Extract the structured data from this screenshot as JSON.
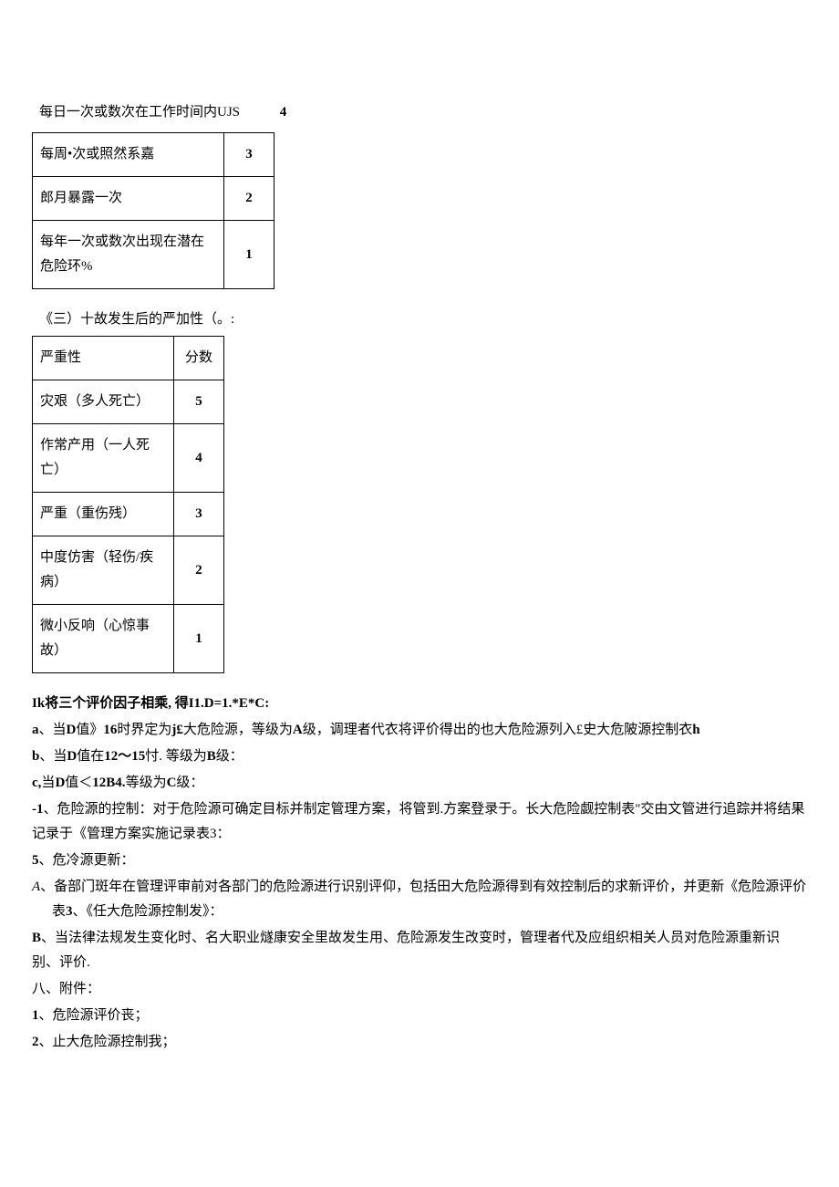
{
  "preTable1": {
    "leftText": "每日一次或数次在工作时间内UJS",
    "rightText": "4"
  },
  "table1": {
    "rows": [
      {
        "label": "每周•次或照然系嘉",
        "score": "3"
      },
      {
        "label": "郎月暴露一次",
        "score": "2"
      },
      {
        "label": "每年一次或数次出现在潜在危险环%",
        "score": "1"
      }
    ]
  },
  "section2Title": "《三）十故发生后的严加性（。:",
  "table2": {
    "header": {
      "label": "严重性",
      "score": "分数"
    },
    "rows": [
      {
        "label": "灾艰（多人死亡）",
        "score": "5"
      },
      {
        "label": "作常产用（一人死亡）",
        "score": "4"
      },
      {
        "label": "严重（重伤残）",
        "score": "3"
      },
      {
        "label": "中度仿害（轻伤/疾病）",
        "score": "2"
      },
      {
        "label": "微小反响（心惊事故）",
        "score": "1"
      }
    ]
  },
  "paras": {
    "p1_prefix": "Ik",
    "p1_rest": "将三个评价因子相乘, 得I1.D=1.*E*C:",
    "p2_prefix": "a",
    "p2_mid1": "、当",
    "p2_mid2": "D",
    "p2_mid3": "值》",
    "p2_mid4": "16",
    "p2_mid5": "时界定为",
    "p2_mid6": "j£",
    "p2_mid7": "大危险源，等级为",
    "p2_mid8": "A",
    "p2_mid9": "级，调理者代衣将评价得出的也大危险源列入£史大危陂源控制衣",
    "p2_suffix": "h",
    "p3_prefix": "b",
    "p3_mid1": "、当",
    "p3_mid2": "D",
    "p3_mid3": "值在",
    "p3_mid4": "12〜15",
    "p3_mid5": "忖. 等级为",
    "p3_mid6": "B",
    "p3_mid7": "级：",
    "p4_prefix": "c,",
    "p4_mid1": "当",
    "p4_mid2": "D",
    "p4_mid3": "值＜",
    "p4_mid4": "12B4.",
    "p4_mid5": "等级为",
    "p4_mid6": "C",
    "p4_mid7": "级：",
    "p5_prefix": "-1",
    "p5_rest": "、危险源的控制：对于危险源可确定目标并制定管理方案，将管到.方案登录于。长大危险觑控制表\"交由文管进行追踪并将结果记录于《管理方案实施记录表3：",
    "p6_prefix": "5",
    "p6_rest": "、危冷源更新：",
    "p7_prefix": "A",
    "p7_mid1": "、备部门斑年在管理评审前对各部门的危险源进行识别评仰，包括田大危险源得到有效控制后的求新评价，并更新《危险源评价表",
    "p7_mid2": "3",
    "p7_mid3": "、《任大危险源控制发》：",
    "p8_prefix": "B",
    "p8_rest": "、当法律法规发生变化时、名大职业燧康安全里故发生用、危险源发生改变时，管理者代及应组织相关人员对危险源重新识别、评价.",
    "p9": "八、附件：",
    "p10_prefix": "1",
    "p10_rest": "、危险源评价丧；",
    "p11_prefix": "2",
    "p11_rest": "、止大危险源控制我；"
  }
}
